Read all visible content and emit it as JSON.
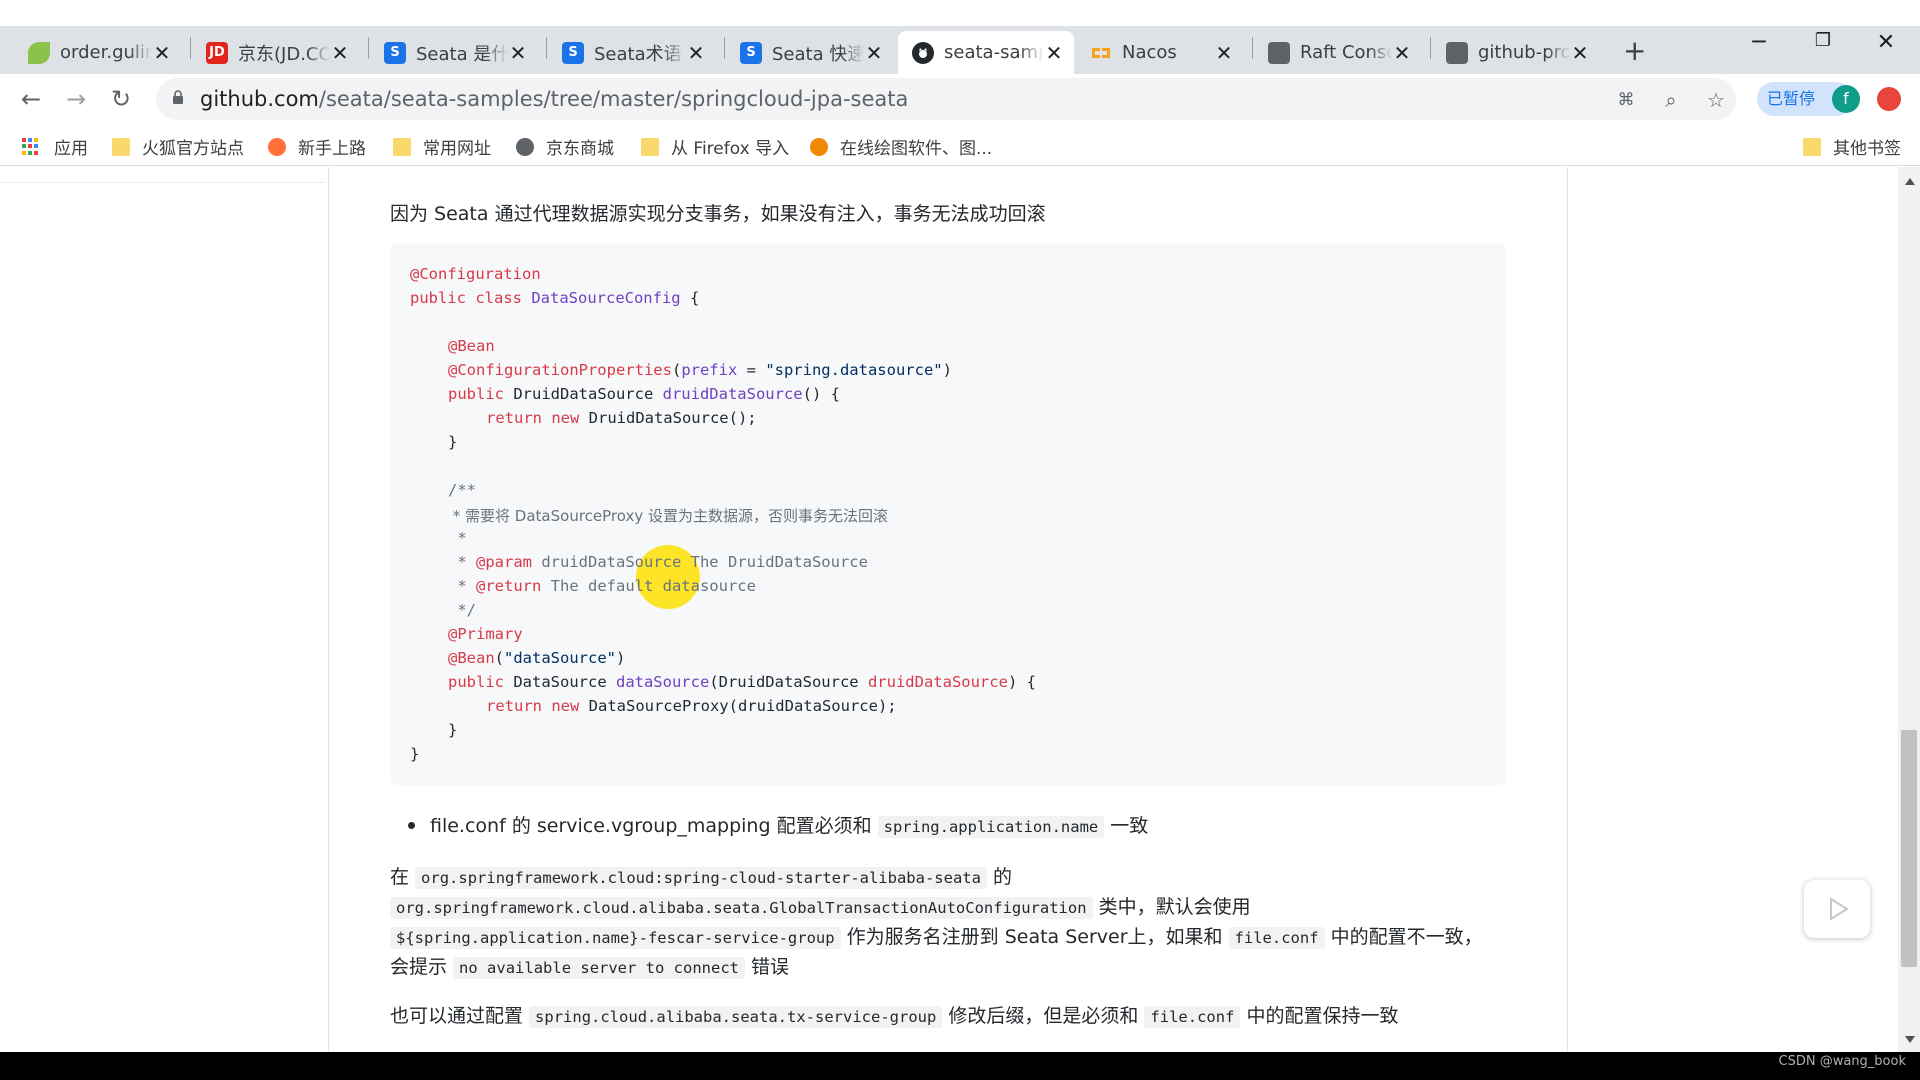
{
  "tabs": [
    {
      "label": "order.gulim",
      "icon": "leaf-icon",
      "color": "#8bc34a",
      "glyph": ""
    },
    {
      "label": "京东(JD.COM)",
      "icon": "jd-icon",
      "color": "#e1251b",
      "glyph": "JD"
    },
    {
      "label": "Seata 是什么",
      "icon": "seata-icon",
      "color": "#1a73e8",
      "glyph": "S"
    },
    {
      "label": "Seata术语",
      "icon": "seata-icon",
      "color": "#1a73e8",
      "glyph": "S"
    },
    {
      "label": "Seata 快速开始",
      "icon": "seata-icon",
      "color": "#1a73e8",
      "glyph": "S"
    },
    {
      "label": "seata-samples",
      "icon": "github-icon",
      "color": "#24292e",
      "glyph": ""
    },
    {
      "label": "Nacos",
      "icon": "nacos-icon",
      "color": "#f7a21c",
      "glyph": ""
    },
    {
      "label": "Raft Consensus",
      "icon": "globe-icon",
      "color": "#5f6368",
      "glyph": ""
    },
    {
      "label": "github-proxy",
      "icon": "globe-icon",
      "color": "#5f6368",
      "glyph": ""
    }
  ],
  "url": {
    "host": "github.com",
    "path": "/seata/seata-samples/tree/master/springcloud-jpa-seata"
  },
  "profile": {
    "paused_label": "已暂停",
    "initial": "f"
  },
  "bookmarks": [
    {
      "label": "应用",
      "icon": "apps-grid-icon"
    },
    {
      "label": "火狐官方站点",
      "icon": "folder-icon"
    },
    {
      "label": "新手上路",
      "icon": "firefox-icon"
    },
    {
      "label": "常用网址",
      "icon": "folder-icon"
    },
    {
      "label": "京东商城",
      "icon": "globe-icon"
    },
    {
      "label": "从 Firefox 导入",
      "icon": "folder-icon"
    },
    {
      "label": "在线绘图软件、图...",
      "icon": "drawio-icon"
    },
    {
      "label": "其他书签",
      "icon": "folder-icon"
    }
  ],
  "content": {
    "intro": "因为 Seata 通过代理数据源实现分支事务，如果没有注入，事务无法成功回滚",
    "code": {
      "l1_an": "@Configuration",
      "l2_kw": "public class ",
      "l2_ty": "DataSourceConfig",
      "l2_rest": " {",
      "l4_an": "@Bean",
      "l5_an": "@ConfigurationProperties",
      "l5_a": "(",
      "l5_param": "prefix",
      "l5_eq": " = ",
      "l5_st": "\"spring.datasource\"",
      "l5_end": ")",
      "l6_kw": "public ",
      "l6_type": "DruidDataSource ",
      "l6_ty": "druidDataSource",
      "l6_rest": "() {",
      "l7_kw": "return new ",
      "l7_rest": "DruidDataSource();",
      "close_brace": "}",
      "c1": "/**",
      "c2": " * 需要将 DataSourceProxy 设置为主数据源，否则事务无法回滚",
      "c3": " *",
      "c4_star": " * ",
      "c4_an": "@param",
      "c4_rest": " druidDataSource The DruidDataSource",
      "c5_star": " * ",
      "c5_an": "@return",
      "c5_rest": " The default datasource",
      "c6": " */",
      "l14_an": "@Primary",
      "l15_an": "@Bean",
      "l15_a": "(",
      "l15_st": "\"dataSource\"",
      "l15_end": ")",
      "l16_kw": "public ",
      "l16_type": "DataSource ",
      "l16_ty": "dataSource",
      "l16_a": "(DruidDataSource ",
      "l16_param": "druidDataSource",
      "l16_end": ") {",
      "l17_kw": "return new ",
      "l17_rest": "DataSourceProxy(druidDataSource);"
    },
    "bullet": {
      "pre": "file.conf 的 service.vgroup_mapping 配置必须和 ",
      "code": "spring.application.name",
      "post": " 一致"
    },
    "p2": {
      "a": "在 ",
      "code1": "org.springframework.cloud:spring-cloud-starter-alibaba-seata",
      "b": " 的",
      "code2": "org.springframework.cloud.alibaba.seata.GlobalTransactionAutoConfiguration",
      "c": " 类中，默认会使用",
      "code3": "${spring.application.name}-fescar-service-group",
      "d": " 作为服务名注册到 Seata Server上，如果和 ",
      "code4": "file.conf",
      "e": " 中的配置不一致，",
      "f": "会提示 ",
      "code5": "no available server to connect",
      "g": " 错误"
    },
    "p3": {
      "a": "也可以通过配置 ",
      "code1": "spring.cloud.alibaba.seata.tx-service-group",
      "b": " 修改后缀，但是必须和 ",
      "code2": "file.conf",
      "c": " 中的配置保持一致"
    }
  },
  "watermark": "CSDN @wang_book"
}
